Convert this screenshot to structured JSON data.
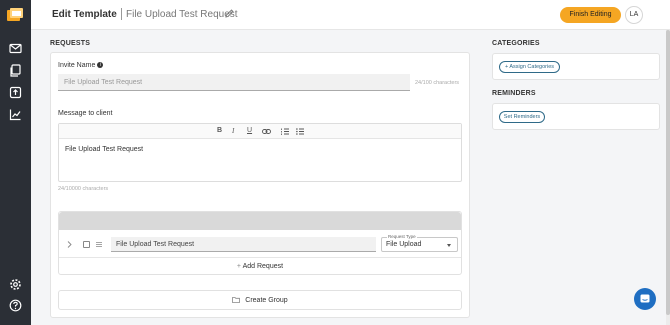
{
  "header": {
    "title": "Edit Template",
    "template_name": "File Upload Test Request",
    "finish_label": "Finish Editing",
    "avatar_initials": "LA"
  },
  "requests": {
    "section_title": "REQUESTS",
    "invite_name_label": "Invite Name",
    "invite_name_value": "File Upload Test Request",
    "invite_name_counter": "24/100 characters",
    "message_label": "Message to client",
    "message_text": "File Upload Test Request",
    "message_counter": "24/10000 characters",
    "request_item": {
      "name": "File Upload Test Request",
      "type_label": "Request Type",
      "type_value": "File Upload"
    },
    "add_request_label": "Add Request",
    "create_group_label": "Create Group"
  },
  "categories": {
    "section_title": "CATEGORIES",
    "assign_label": "+ Assign Categories"
  },
  "reminders": {
    "section_title": "REMINDERS",
    "set_label": "Set Reminders"
  },
  "colors": {
    "sidebar": "#2b2f36",
    "accent": "#f5a623",
    "link": "#2f6a88",
    "chat": "#1f6ec2"
  },
  "icons": [
    "logo-icon",
    "mail-icon",
    "documents-icon",
    "upload-icon",
    "reports-icon",
    "settings-icon",
    "help-icon",
    "pencil-icon",
    "info-icon",
    "bold-icon",
    "italic-icon",
    "underline-icon",
    "link-icon",
    "ordered-list-icon",
    "bullet-list-icon",
    "chevron-right-icon",
    "checkbox-icon",
    "drag-handle-icon",
    "plus-icon",
    "folder-icon",
    "chat-icon"
  ]
}
